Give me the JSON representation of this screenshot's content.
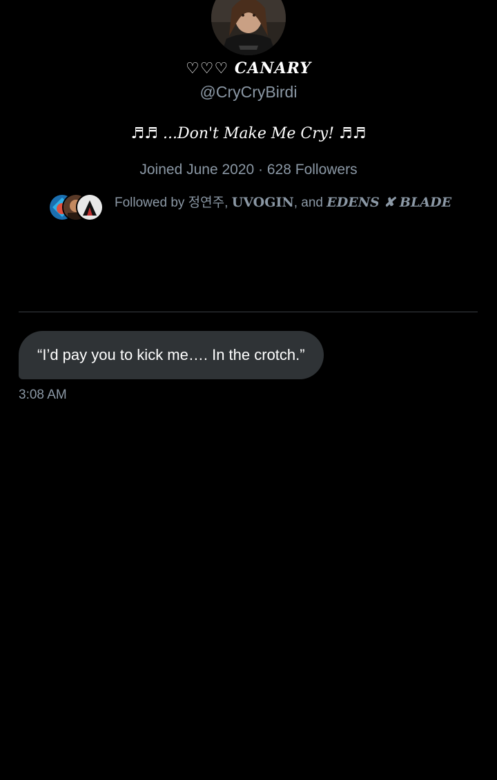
{
  "profile": {
    "display_name": "♡♡♡ CANARY",
    "handle": "@CryCryBirdi",
    "bio": "♬♬ ...Don't Make Me Cry! ♬♬",
    "joined": "Joined June 2020",
    "separator": "·",
    "followers": "628 Followers"
  },
  "followed_by": {
    "prefix": "Followed by ",
    "name1": "정연주",
    "sep1": ", ",
    "name2": "UVOGIN",
    "sep2": ", and ",
    "name3": "EDENS ✘ BLADE"
  },
  "message": {
    "text": "“I’d pay you to kick me…. In the crotch.”",
    "time": "3:08 AM"
  },
  "colors": {
    "background": "#000000",
    "bubble": "#2f3336",
    "secondary_text": "#8b98a5",
    "divider": "#3a3f44"
  }
}
